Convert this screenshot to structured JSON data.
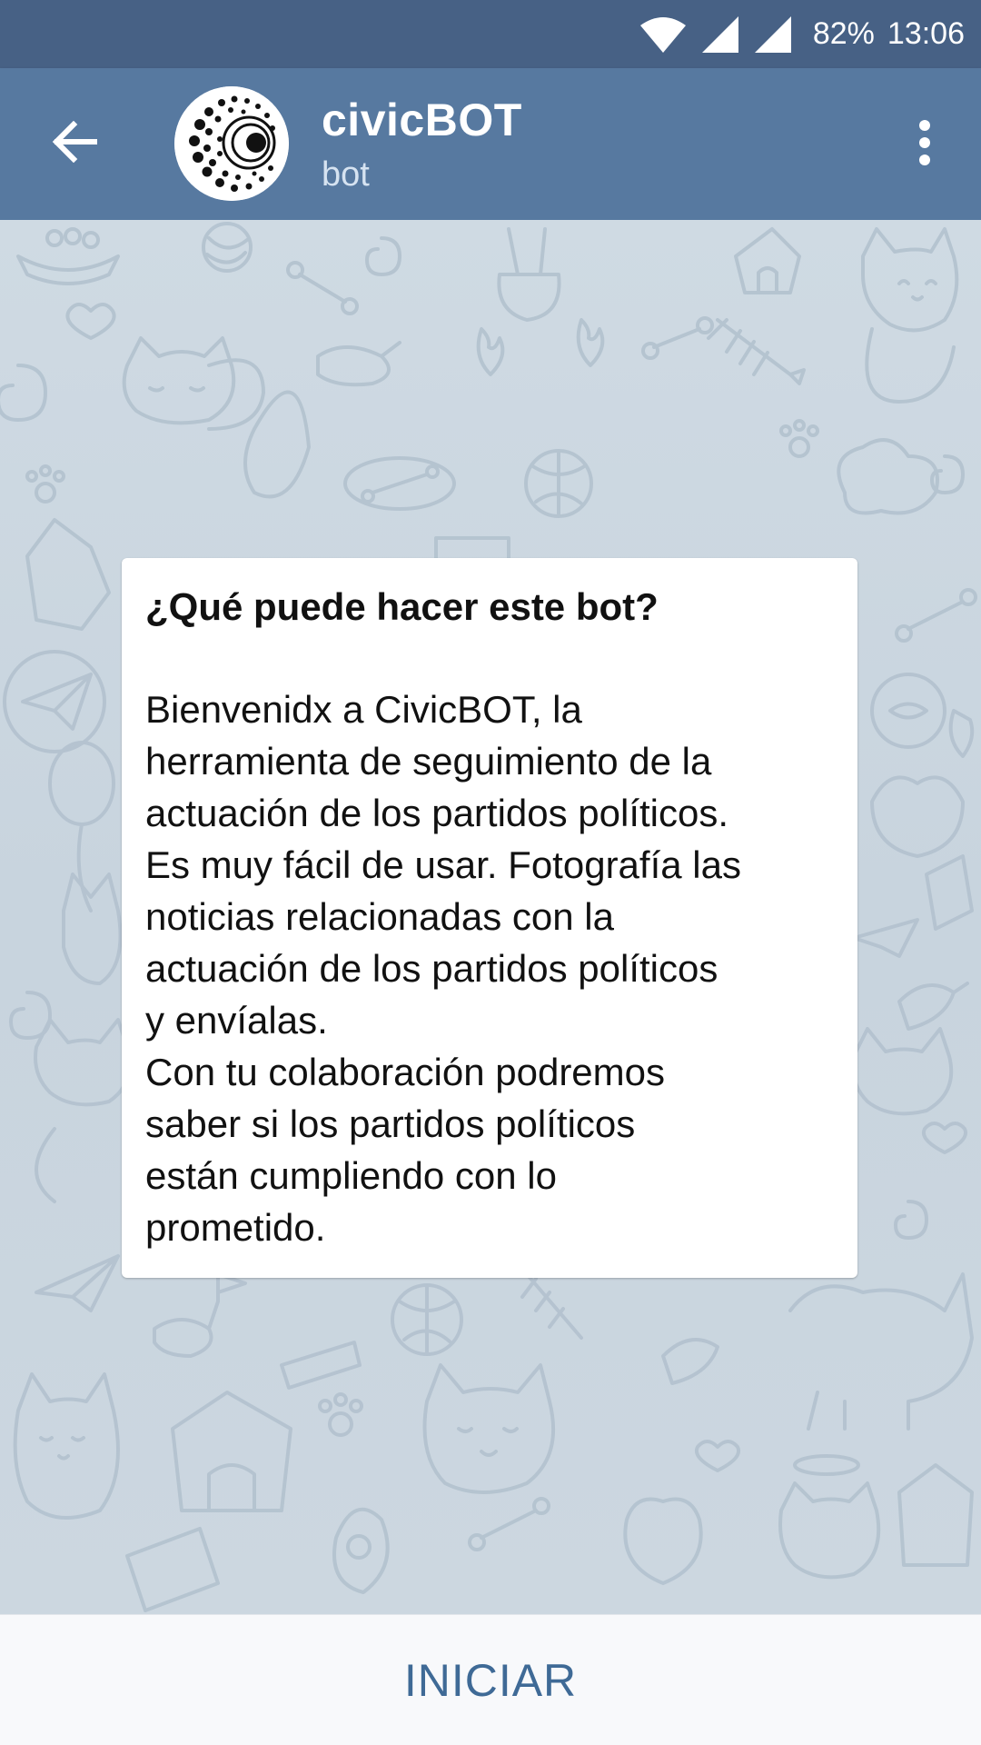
{
  "status_bar": {
    "battery": "82%",
    "time": "13:06",
    "icons": [
      "wifi-icon",
      "signal-icon",
      "signal-icon"
    ]
  },
  "header": {
    "back_icon": "arrow-left-icon",
    "title": "civicBOT",
    "subtitle": "bot",
    "menu_icon": "more-vert-icon"
  },
  "info_card": {
    "title": "¿Qué puede hacer este bot?",
    "body": "Bienvenidx a CivicBOT, la\nherramienta de seguimiento de la\nactuación de los partidos políticos.\nEs muy fácil de usar. Fotografía las\nnoticias relacionadas con la\nactuación de los partidos políticos\ny envíalas.\nCon tu colaboración podremos\nsaber si los partidos políticos\nestán cumpliendo con lo\nprometido."
  },
  "bottom": {
    "start_label": "INICIAR"
  },
  "colors": {
    "status_bar": "#476185",
    "app_bar": "#5779a0",
    "chat_bg": "#cfdae2",
    "accent": "#3f6a96"
  }
}
